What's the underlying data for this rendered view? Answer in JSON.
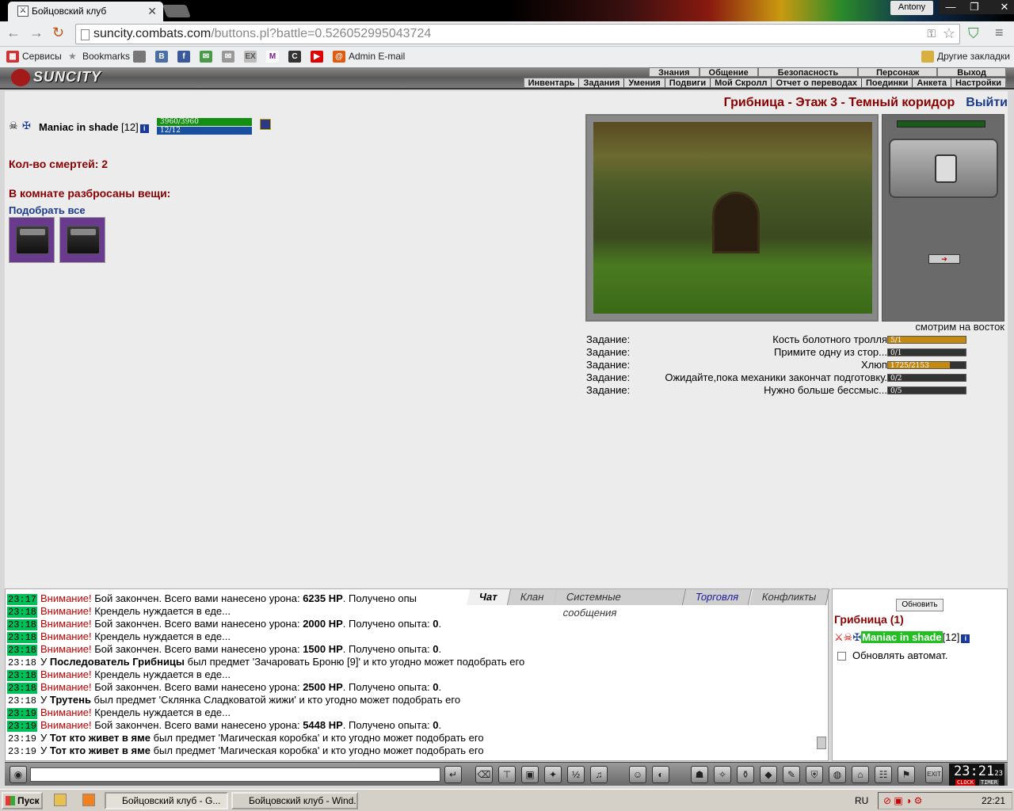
{
  "browser": {
    "tab_title": "Бойцовский клуб",
    "close": "✕",
    "user": "Antony",
    "url_host": "suncity.combats.com",
    "url_path": "/buttons.pl?battle=0.526052995043724",
    "bookmarks": [
      "Сервисы",
      "Bookmarks",
      "Admin E-mail",
      "Другие закладки"
    ]
  },
  "game": {
    "logo": "SUNCITY",
    "top_menu": [
      "Знания",
      "Общение",
      "Безопасность",
      "Персонаж",
      "Выход"
    ],
    "sub_menu": [
      "Инвентарь",
      "Задания",
      "Умения",
      "Подвиги",
      "Мой Скролл",
      "Отчет о переводах",
      "Поединки",
      "Анкета",
      "Настройки"
    ],
    "location": "Грибница - Этаж 3 - Темный коридор",
    "exit": "Выйти",
    "player": {
      "name": "Maniac in shade",
      "level": "[12]",
      "hp": "3960/3960",
      "mp": "12/12"
    },
    "deaths": "Кол-во смертей: 2",
    "items_title": "В комнате разбросаны вещи:",
    "pick_all": "Подобрать все",
    "look": "смотрим на восток",
    "tasks": [
      {
        "label": "Задание:",
        "name": "Кость болотного тролля",
        "progress": "5/1",
        "fill": 1.0
      },
      {
        "label": "Задание:",
        "name": "Примите одну из стор...",
        "progress": "0/1",
        "fill": 0
      },
      {
        "label": "Задание:",
        "name": "Хлюп",
        "progress": "1725/2153",
        "fill": 0.8
      },
      {
        "label": "Задание:",
        "name": "Ожидайте,пока механики закончат подготовку.",
        "progress": "0/2",
        "fill": 0
      },
      {
        "label": "Задание:",
        "name": "Нужно больше бессмыс...",
        "progress": "0/5",
        "fill": 0
      }
    ]
  },
  "chat": {
    "tabs": [
      "Чат",
      "Клан",
      "Системные сообщения",
      "Торговля",
      "Конфликты"
    ]
  },
  "online": {
    "refresh": "Обновить",
    "title": "Грибница (1)",
    "user": "Maniac in shade",
    "level": "[12]",
    "auto": "Обновлять автомат."
  },
  "clock": {
    "time": "23:21",
    "sec": "23",
    "clock_lbl": "CLOCK",
    "timer_lbl": "TIMER",
    "exit_lbl": "EXIT"
  },
  "taskbar": {
    "start": "Пуск",
    "t1": "Бойцовский клуб - G...",
    "t2": "Бойцовский клуб - Wind...",
    "lang": "RU",
    "time": "22:21"
  }
}
